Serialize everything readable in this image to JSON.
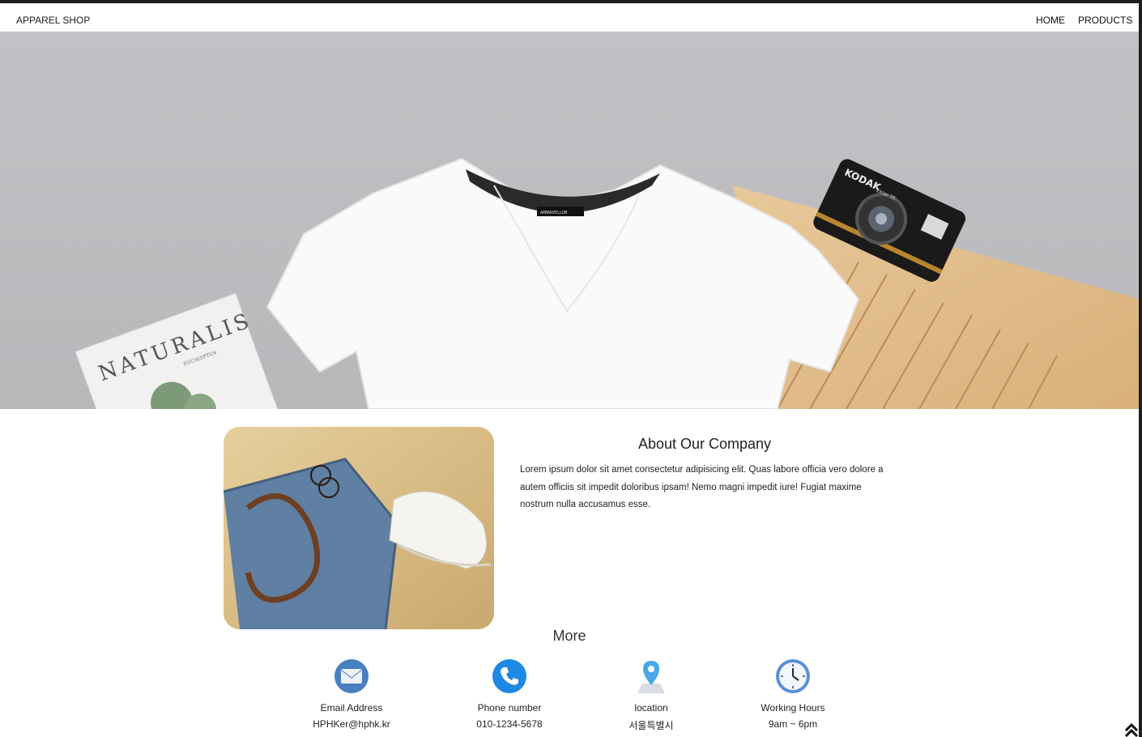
{
  "navbar": {
    "brand": "APPAREL SHOP",
    "links": [
      {
        "label": "HOME"
      },
      {
        "label": "PRODUCTS"
      }
    ]
  },
  "hero": {
    "magazine_title": "NATURALIS",
    "magazine_subtitle": "EUCALYPTUS",
    "shirt_tag": "ARMARVELLUM",
    "camera_brand": "KODAK",
    "camera_model": "Ektar 35"
  },
  "about": {
    "title": "About Our Company",
    "text": "Lorem ipsum dolor sit amet consectetur adipisicing elit. Quas labore officia vero dolore a autem officiis sit impedit doloribus ipsam! Nemo magni impedit iure! Fugiat maxime nostrum nulla accusamus esse."
  },
  "more": {
    "title": "More",
    "items": [
      {
        "icon": "envelope-icon",
        "label": "Email Address",
        "value": "HPHKer@hphk.kr"
      },
      {
        "icon": "phone-icon",
        "label": "Phone number",
        "value": "010-1234-5678"
      },
      {
        "icon": "location-pin-icon",
        "label": "location",
        "value": "서울특별시"
      },
      {
        "icon": "clock-icon",
        "label": "Working Hours",
        "value": "9am ~ 6pm"
      }
    ]
  },
  "colors": {
    "hero_background": "#bfbdc0",
    "icon_blue": "#1e88e5",
    "text": "#222222"
  }
}
